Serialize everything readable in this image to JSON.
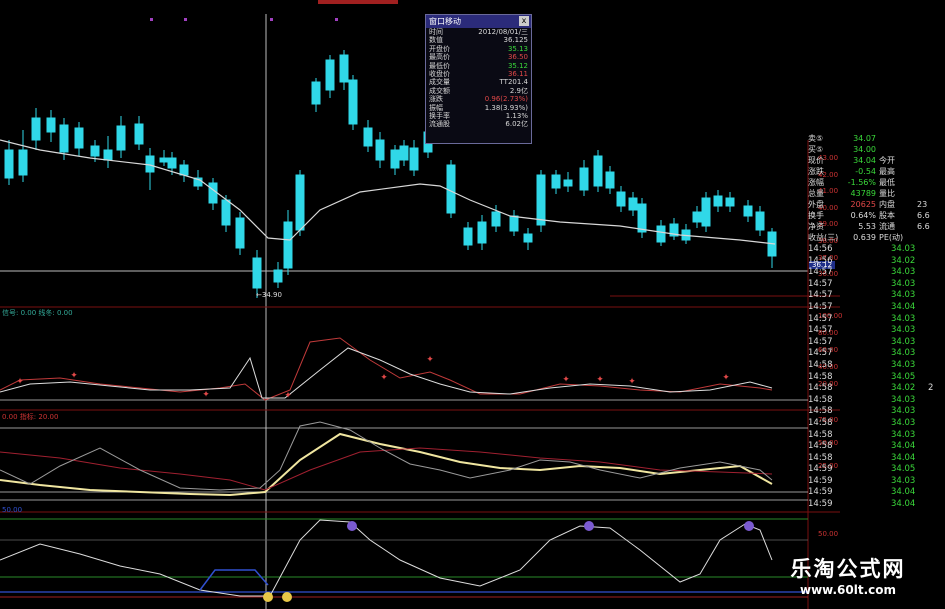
{
  "popup": {
    "title": "窗口移动",
    "close_label": "x",
    "rows": [
      {
        "k": "时间",
        "v": "2012/08/01/三",
        "c": "white"
      },
      {
        "k": "数值",
        "v": "36.125",
        "c": "white"
      },
      {
        "k": "开盘价",
        "v": "35.13",
        "c": "green"
      },
      {
        "k": "最高价",
        "v": "36.50",
        "c": "red"
      },
      {
        "k": "最低价",
        "v": "35.12",
        "c": "green"
      },
      {
        "k": "收盘价",
        "v": "36.11",
        "c": "red"
      },
      {
        "k": "成交量",
        "v": "TT201.4",
        "c": "white"
      },
      {
        "k": "成交额",
        "v": "2.9亿",
        "c": "white"
      },
      {
        "k": "涨跌",
        "v": "0.96(2.73%)",
        "c": "red"
      },
      {
        "k": "振幅",
        "v": "1.38(3.93%)",
        "c": "white"
      },
      {
        "k": "换手率",
        "v": "1.13%",
        "c": "white"
      },
      {
        "k": "流通股",
        "v": "6.02亿",
        "c": "white"
      }
    ]
  },
  "price_axis": [
    "43.00",
    "42.00",
    "41.00",
    "40.00",
    "39.00",
    "38.00",
    "37.00"
  ],
  "price_marker": "36.12",
  "price_bottom": "36.00",
  "low_label": "←34.90",
  "indicator_labels": {
    "p1_left": "信号: 0.00  线冬: 0.00",
    "p2_left": "0.00  指标: 20.00",
    "p3_left": "50.00",
    "p1_axis": [
      "100.00",
      "80.00",
      "60.00",
      "40.00",
      "20.00"
    ],
    "p2_axis": [
      "75.00",
      "50.00",
      "25.00"
    ],
    "p4_axis": [
      "50.00"
    ]
  },
  "quote": {
    "rows": [
      {
        "a": "卖⑤",
        "b": "34.07",
        "c": "",
        "d": ""
      },
      {
        "a": "买⑤",
        "b": "34.00",
        "c": "",
        "d": ""
      },
      {
        "a": "现价",
        "b": "34.04",
        "c": "今开",
        "d": ""
      },
      {
        "a": "涨跌",
        "b": "-0.54",
        "c": "最高",
        "d": ""
      },
      {
        "a": "涨幅",
        "b": "-1.56%",
        "c": "最低",
        "d": ""
      },
      {
        "a": "总量",
        "b": "43789",
        "c": "量比",
        "d": ""
      },
      {
        "a": "外盘",
        "b": "20625",
        "c": "内盘",
        "d": "23"
      },
      {
        "a": "换手",
        "b": "0.64%",
        "c": "股本",
        "d": "6.6"
      },
      {
        "a": "净资",
        "b": "5.53",
        "c": "流通",
        "d": "6.6"
      },
      {
        "a": "收益(三)",
        "b": "0.639",
        "c": "PE(动)",
        "d": ""
      }
    ],
    "ticks": [
      {
        "t": "14:56",
        "p": "34.03",
        "v": ""
      },
      {
        "t": "14:56",
        "p": "34.02",
        "v": ""
      },
      {
        "t": "14:57",
        "p": "34.03",
        "v": ""
      },
      {
        "t": "14:57",
        "p": "34.03",
        "v": ""
      },
      {
        "t": "14:57",
        "p": "34.03",
        "v": ""
      },
      {
        "t": "14:57",
        "p": "34.04",
        "v": ""
      },
      {
        "t": "14:57",
        "p": "34.03",
        "v": ""
      },
      {
        "t": "14:57",
        "p": "34.03",
        "v": ""
      },
      {
        "t": "14:57",
        "p": "34.03",
        "v": ""
      },
      {
        "t": "14:57",
        "p": "34.03",
        "v": ""
      },
      {
        "t": "14:58",
        "p": "34.03",
        "v": ""
      },
      {
        "t": "14:58",
        "p": "34.05",
        "v": ""
      },
      {
        "t": "14:58",
        "p": "34.02",
        "v": "2"
      },
      {
        "t": "14:58",
        "p": "34.03",
        "v": ""
      },
      {
        "t": "14:58",
        "p": "34.03",
        "v": ""
      },
      {
        "t": "14:58",
        "p": "34.03",
        "v": ""
      },
      {
        "t": "14:58",
        "p": "34.03",
        "v": ""
      },
      {
        "t": "14:58",
        "p": "34.04",
        "v": ""
      },
      {
        "t": "14:58",
        "p": "34.04",
        "v": ""
      },
      {
        "t": "14:59",
        "p": "34.05",
        "v": ""
      },
      {
        "t": "14:59",
        "p": "34.03",
        "v": ""
      },
      {
        "t": "14:59",
        "p": "34.04",
        "v": ""
      },
      {
        "t": "14:59",
        "p": "34.04",
        "v": ""
      }
    ]
  },
  "watermark": {
    "title": "乐淘公式网",
    "url": "www.60lt.com"
  },
  "colors": {
    "up": "#e04848",
    "down": "#30d8e8",
    "ma": "#d8d8d8",
    "quote_green": "#3ad83a",
    "panel_line": "#7a1010"
  }
}
